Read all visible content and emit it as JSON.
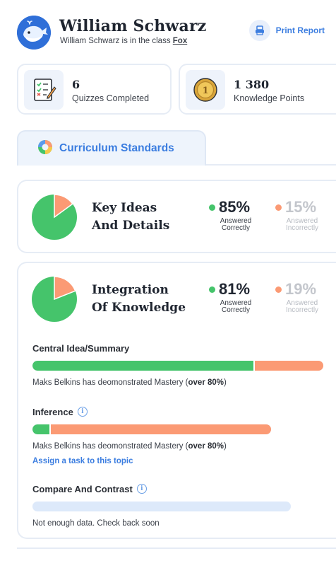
{
  "header": {
    "student_name": "William Schwarz",
    "class_prefix": "William Schwarz is in the class ",
    "class_name": "Fox",
    "print_label": "Print Report",
    "avatar_icon": "whale-avatar-icon",
    "print_icon": "printer-icon"
  },
  "stats": [
    {
      "value": "6",
      "label": "Quizzes Completed",
      "icon": "quiz-checklist-icon"
    },
    {
      "value": "1 380",
      "label": "Knowledge Points",
      "icon": "gold-coin-icon"
    }
  ],
  "tabs": [
    {
      "label": "Curriculum Standards",
      "icon": "pie-chart-icon",
      "active": true
    }
  ],
  "colors": {
    "correct": "#45c46b",
    "incorrect": "#fb9a74",
    "accent": "#3b7de0",
    "empty_bar": "#dde9fa"
  },
  "standards": [
    {
      "title_line1": "Key Ideas",
      "title_line2": "And Details",
      "correct_pct": "85%",
      "correct_label1": "Answered",
      "correct_label2": "Correctly",
      "incorrect_pct": "15%",
      "incorrect_label1": "Answered",
      "incorrect_label2": "Incorrectly",
      "correct_fraction": 0.85
    },
    {
      "title_line1": "Integration",
      "title_line2": "Of Knowledge",
      "correct_pct": "81%",
      "correct_label1": "Answered",
      "correct_label2": "Correctly",
      "incorrect_pct": "19%",
      "incorrect_label1": "Answered",
      "incorrect_label2": "Incorrectly",
      "correct_fraction": 0.81,
      "topics": [
        {
          "title": "Central Idea/Summary",
          "has_info": false,
          "correct_fraction": 0.76,
          "incorrect_fraction": 0.24,
          "note_prefix": "Maks Belkins has deomonstrated Mastery (",
          "note_bold": "over 80%",
          "note_suffix": ")",
          "link": ""
        },
        {
          "title": "Inference",
          "has_info": true,
          "correct_fraction": 0.07,
          "incorrect_fraction": 0.93,
          "note_prefix": "Maks Belkins has deomonstrated Mastery (",
          "note_bold": "over 80%",
          "note_suffix": ")",
          "link": "Assign a task to this topic"
        },
        {
          "title": "Compare And Contrast",
          "has_info": true,
          "correct_fraction": 0,
          "incorrect_fraction": 0,
          "note_prefix": "Not enough data. Check back soon",
          "note_bold": "",
          "note_suffix": "",
          "link": ""
        }
      ]
    }
  ]
}
